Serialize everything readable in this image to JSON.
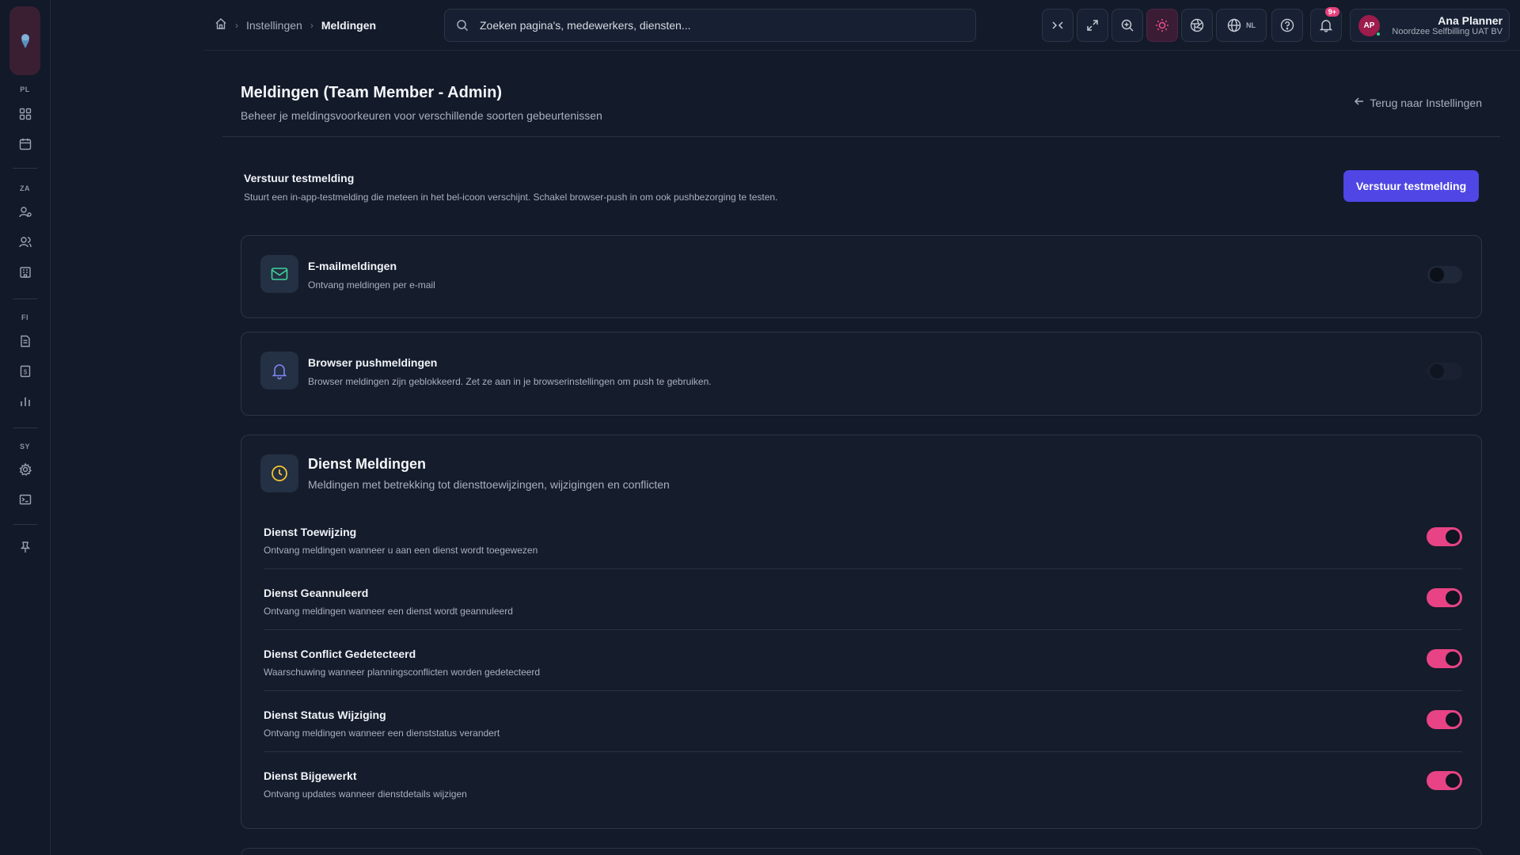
{
  "sidebar": {
    "groups": [
      {
        "label": "PL",
        "items": [
          {
            "icon": "grid-icon"
          },
          {
            "icon": "calendar-icon"
          }
        ]
      },
      {
        "label": "ZA",
        "items": [
          {
            "icon": "user-cog-icon"
          },
          {
            "icon": "users-icon"
          },
          {
            "icon": "building-icon"
          }
        ]
      },
      {
        "label": "FI",
        "items": [
          {
            "icon": "document-icon"
          },
          {
            "icon": "invoice-icon"
          },
          {
            "icon": "bar-chart-icon"
          }
        ]
      },
      {
        "label": "SY",
        "items": [
          {
            "icon": "gear-icon"
          },
          {
            "icon": "terminal-icon"
          }
        ]
      }
    ]
  },
  "header": {
    "breadcrumb": [
      "Instellingen",
      "Meldingen"
    ],
    "search_placeholder": "Zoeken pagina's, medewerkers, diensten...",
    "language": "NL",
    "notification_badge": "9+",
    "user": {
      "initials": "AP",
      "name": "Ana Planner",
      "org": "Noordzee Selfbilling UAT BV"
    }
  },
  "page": {
    "title": "Meldingen (Team Member - Admin)",
    "subtitle": "Beheer je meldingsvoorkeuren voor verschillende soorten gebeurtenissen",
    "back_label": "Terug naar Instellingen"
  },
  "test": {
    "title": "Verstuur testmelding",
    "description": "Stuurt een in-app-testmelding die meteen in het bel-icoon verschijnt. Schakel browser-push in om ook pushbezorging te testen.",
    "button_label": "Verstuur testmelding"
  },
  "email": {
    "title": "E-mailmeldingen",
    "description": "Ontvang meldingen per e-mail",
    "enabled": false
  },
  "push": {
    "title": "Browser pushmeldingen",
    "description": "Browser meldingen zijn geblokkeerd. Zet ze aan in je browserinstellingen om push te gebruiken.",
    "enabled": false
  },
  "shifts": {
    "title": "Dienst Meldingen",
    "description": "Meldingen met betrekking tot diensttoewijzingen, wijzigingen en conflicten",
    "rows": [
      {
        "title": "Dienst Toewijzing",
        "description": "Ontvang meldingen wanneer u aan een dienst wordt toegewezen",
        "enabled": true
      },
      {
        "title": "Dienst Geannuleerd",
        "description": "Ontvang meldingen wanneer een dienst wordt geannuleerd",
        "enabled": true
      },
      {
        "title": "Dienst Conflict Gedetecteerd",
        "description": "Waarschuwing wanneer planningsconflicten worden gedetecteerd",
        "enabled": true
      },
      {
        "title": "Dienst Status Wijziging",
        "description": "Ontvang meldingen wanneer een dienststatus verandert",
        "enabled": true
      },
      {
        "title": "Dienst Bijgewerkt",
        "description": "Ontvang updates wanneer dienstdetails wijzigen",
        "enabled": true
      }
    ]
  },
  "colors": {
    "accent": "#e84384",
    "primary_button": "#4f46e5",
    "background": "#131a2a"
  }
}
